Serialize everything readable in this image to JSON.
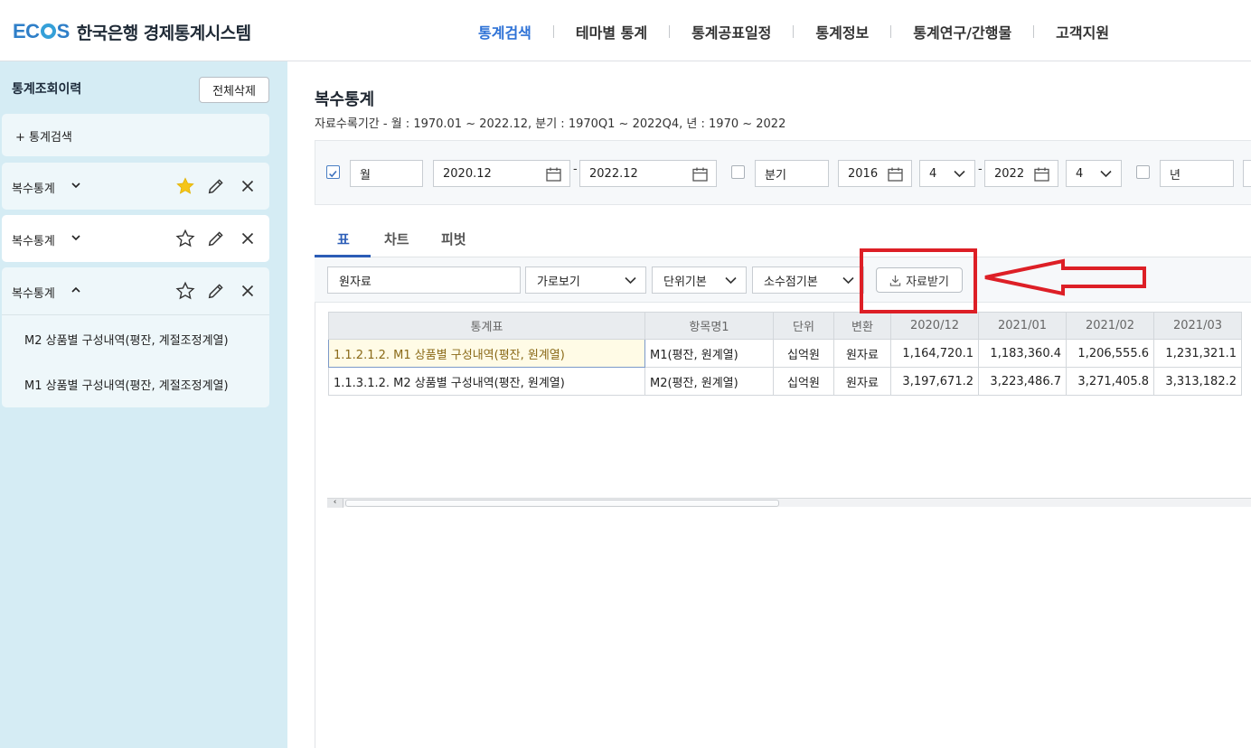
{
  "header": {
    "brand": "ECOS",
    "brand_prefix": "EC",
    "brand_suffix": "S",
    "site_name": "한국은행 경제통계시스템",
    "nav": [
      {
        "label": "통계검색",
        "active": true
      },
      {
        "label": "테마별 통계",
        "active": false
      },
      {
        "label": "통계공표일정",
        "active": false
      },
      {
        "label": "통계정보",
        "active": false
      },
      {
        "label": "통계연구/간행물",
        "active": false
      },
      {
        "label": "고객지원",
        "active": false
      }
    ]
  },
  "sidebar": {
    "title": "통계조회이력",
    "delete_all_label": "전체삭제",
    "search_label": "+ 통계검색",
    "items": [
      {
        "label": "복수통계",
        "expanded": false,
        "starred": true
      },
      {
        "label": "복수통계",
        "expanded": false,
        "starred": false
      },
      {
        "label": "복수통계",
        "expanded": true,
        "starred": false
      }
    ],
    "sub_items": [
      "M2 상품별 구성내역(평잔, 계절조정계열)",
      "M1 상품별 구성내역(평잔, 계절조정계열)"
    ]
  },
  "main": {
    "title": "복수통계",
    "period": "자료수록기간 - 월 : 1970.01 ~ 2022.12, 분기 : 1970Q1 ~ 2022Q4, 년 : 1970 ~ 2022",
    "filters": {
      "month_checked": true,
      "month_label": "월",
      "month_from": "2020.12",
      "month_to": "2022.12",
      "range_sep": "-",
      "quarter_checked": false,
      "quarter_label": "분기",
      "quarter_from_year": "2016",
      "quarter_from_q": "4",
      "quarter_to_year": "2022",
      "quarter_to_q": "4",
      "year_checked": false,
      "year_label": "년"
    },
    "tabs": [
      "표",
      "차트",
      "피벗"
    ],
    "active_tab": 0,
    "toolbar": {
      "data_type": "원자료",
      "view_mode": "가로보기",
      "unit": "단위기본",
      "decimal": "소수점기본",
      "download_label": "자료받기"
    },
    "table": {
      "columns": [
        "통계표",
        "항목명1",
        "단위",
        "변환",
        "2020/12",
        "2021/01",
        "2021/02",
        "2021/03"
      ],
      "rows": [
        [
          "1.1.2.1.2. M1 상품별 구성내역(평잔, 원계열)",
          "M1(평잔, 원계열)",
          "십억원",
          "원자료",
          "1,164,720.1",
          "1,183,360.4",
          "1,206,555.6",
          "1,231,321.1"
        ],
        [
          "1.1.3.1.2. M2 상품별 구성내역(평잔, 원계열)",
          "M2(평잔, 원계열)",
          "십억원",
          "원자료",
          "3,197,671.2",
          "3,223,486.7",
          "3,271,405.8",
          "3,313,182.2"
        ]
      ]
    }
  },
  "colors": {
    "accent": "#2e72d6",
    "sidebar_bg": "#d5ecf4",
    "annotation_red": "#dd1f26",
    "star_yellow": "#f5c518"
  },
  "icons": {
    "calendar": "calendar-icon",
    "chevron_down": "chevron-down-icon",
    "star": "star-icon",
    "edit": "pencil-icon",
    "close": "close-icon",
    "download": "download-icon"
  }
}
